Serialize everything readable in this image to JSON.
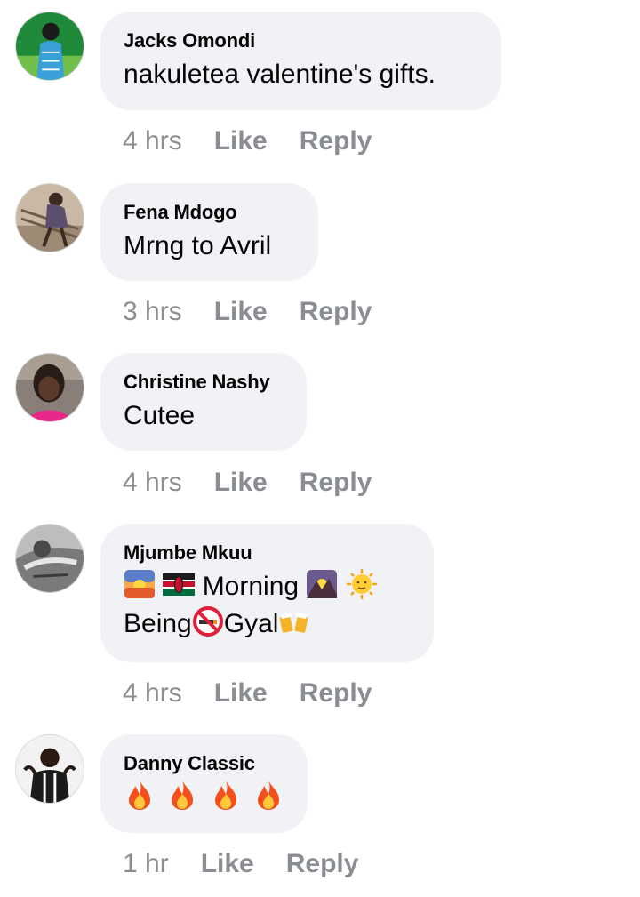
{
  "comments": [
    {
      "author": "Jacks Omondi",
      "text": "nakuletea valentine's gifts.",
      "time": "4 hrs",
      "like": "Like",
      "reply": "Reply"
    },
    {
      "author": "Fena Mdogo",
      "text": "Mrng to Avril",
      "time": "3 hrs",
      "like": "Like",
      "reply": "Reply"
    },
    {
      "author": "Christine Nashy",
      "text": "Cutee",
      "time": "4 hrs",
      "like": "Like",
      "reply": "Reply"
    },
    {
      "author": "Mjumbe Mkuu",
      "line1_word": "Morning",
      "line2_word_a": "Being",
      "line2_word_b": "Gyal",
      "emoji_names": [
        "sunrise-emoji",
        "kenya-flag-emoji",
        "sunrise-over-mountains-emoji",
        "sun-with-face-emoji",
        "no-smoking-emoji",
        "beer-mugs-emoji"
      ],
      "time": "4 hrs",
      "like": "Like",
      "reply": "Reply"
    },
    {
      "author": "Danny Classic",
      "emoji_names": [
        "fire-emoji",
        "fire-emoji",
        "fire-emoji",
        "fire-emoji"
      ],
      "time": "1 hr",
      "like": "Like",
      "reply": "Reply"
    }
  ],
  "colors": {
    "bubble": "#f0f2f5",
    "meta_text": "#8a8d91",
    "name_text": "#050505"
  }
}
